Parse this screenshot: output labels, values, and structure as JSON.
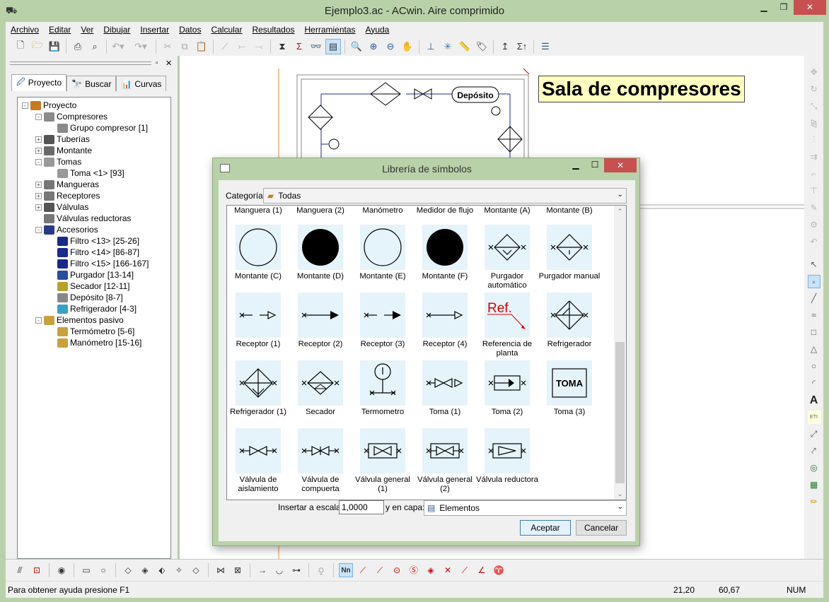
{
  "window": {
    "title": "Ejemplo3.ac - ACwin. Aire comprimido"
  },
  "menu": [
    "Archivo",
    "Editar",
    "Ver",
    "Dibujar",
    "Insertar",
    "Datos",
    "Calcular",
    "Resultados",
    "Herramientas",
    "Ayuda"
  ],
  "panel": {
    "tabs": [
      "Proyecto",
      "Buscar",
      "Curvas"
    ]
  },
  "tree": [
    {
      "label": "Proyecto",
      "level": 0,
      "exp": "-",
      "icon": "folder-icon"
    },
    {
      "label": "Compresores",
      "level": 1,
      "exp": "-",
      "icon": "compressor-icon"
    },
    {
      "label": "Grupo compresor [1]",
      "level": 2,
      "exp": "",
      "icon": "compressor-icon"
    },
    {
      "label": "Tuberías",
      "level": 1,
      "exp": "+",
      "icon": "pipe-icon"
    },
    {
      "label": "Montante",
      "level": 1,
      "exp": "+",
      "icon": "riser-icon"
    },
    {
      "label": "Tomas",
      "level": 1,
      "exp": "-",
      "icon": "outlet-icon"
    },
    {
      "label": "Toma <1> [93]",
      "level": 2,
      "exp": "",
      "icon": "outlet-icon"
    },
    {
      "label": "Mangueras",
      "level": 1,
      "exp": "+",
      "icon": "hose-icon"
    },
    {
      "label": "Receptores",
      "level": 1,
      "exp": "+",
      "icon": "receiver-icon"
    },
    {
      "label": "Válvulas",
      "level": 1,
      "exp": "+",
      "icon": "valve-icon"
    },
    {
      "label": "Válvulas reductoras",
      "level": 1,
      "exp": "",
      "icon": "reducing-valve-icon"
    },
    {
      "label": "Accesorios",
      "level": 1,
      "exp": "-",
      "icon": "accessory-icon"
    },
    {
      "label": "Filtro <13> [25-26]",
      "level": 2,
      "exp": "",
      "icon": "filter-icon"
    },
    {
      "label": "Filtro <14> [86-87]",
      "level": 2,
      "exp": "",
      "icon": "filter-icon"
    },
    {
      "label": "Filtro <15> [166-167]",
      "level": 2,
      "exp": "",
      "icon": "filter-icon"
    },
    {
      "label": "Purgador [13-14]",
      "level": 2,
      "exp": "",
      "icon": "drain-icon"
    },
    {
      "label": "Secador [12-11]",
      "level": 2,
      "exp": "",
      "icon": "dryer-icon"
    },
    {
      "label": "Depósito [8-7]",
      "level": 2,
      "exp": "",
      "icon": "tank-icon"
    },
    {
      "label": "Refrigerador [4-3]",
      "level": 2,
      "exp": "",
      "icon": "cooler-icon"
    },
    {
      "label": "Elementos pasivo",
      "level": 1,
      "exp": "-",
      "icon": "gauge-icon"
    },
    {
      "label": "Termómetro [5-6]",
      "level": 2,
      "exp": "",
      "icon": "gauge-icon"
    },
    {
      "label": "Manómetro [15-16]",
      "level": 2,
      "exp": "",
      "icon": "gauge-icon"
    }
  ],
  "canvas": {
    "room_label": "Sala de compresores",
    "tank_label": "Depósito"
  },
  "dialog": {
    "title": "Librería de símbolos",
    "category_label": "Categoría:",
    "category_value": "Todas",
    "header_labels": [
      "Manguera (1)",
      "Manguera (2)",
      "Manómetro",
      "Medidor de flujo",
      "Montante (A)",
      "Montante (B)"
    ],
    "symbols": [
      {
        "label": "Montante (C)",
        "kind": "circle-open"
      },
      {
        "label": "Montante (D)",
        "kind": "circle-filled"
      },
      {
        "label": "Montante (E)",
        "kind": "circle-open"
      },
      {
        "label": "Montante (F)",
        "kind": "circle-filled"
      },
      {
        "label": "Purgador automático",
        "kind": "drain-auto"
      },
      {
        "label": "Purgador manual",
        "kind": "drain-manual"
      },
      {
        "label": "Receptor (1)",
        "kind": "recv1"
      },
      {
        "label": "Receptor (2)",
        "kind": "recv2"
      },
      {
        "label": "Receptor (3)",
        "kind": "recv3"
      },
      {
        "label": "Receptor (4)",
        "kind": "recv4"
      },
      {
        "label": "Referencia de planta",
        "kind": "ref"
      },
      {
        "label": "Refrigerador",
        "kind": "cooler"
      },
      {
        "label": "Refrigerador (1)",
        "kind": "cooler1"
      },
      {
        "label": "Secador",
        "kind": "dryer"
      },
      {
        "label": "Termometro",
        "kind": "thermo"
      },
      {
        "label": "Toma (1)",
        "kind": "toma1"
      },
      {
        "label": "Toma (2)",
        "kind": "toma2"
      },
      {
        "label": "Toma (3)",
        "kind": "toma3"
      },
      {
        "label": "Válvula de aislamiento",
        "kind": "v-iso"
      },
      {
        "label": "Válvula de compuerta",
        "kind": "v-gate"
      },
      {
        "label": "Válvula general (1)",
        "kind": "v-gen1"
      },
      {
        "label": "Válvula general (2)",
        "kind": "v-gen2"
      },
      {
        "label": "Válvula reductora",
        "kind": "v-red"
      }
    ],
    "ref_text": "Ref.",
    "toma_text": "TOMA",
    "scale_label": "Insertar a escala:",
    "scale_value": "1,0000",
    "layer_label": "y en capa:",
    "layer_value": "Elementos",
    "accept": "Aceptar",
    "cancel": "Cancelar"
  },
  "status": {
    "help": "Para obtener ayuda presione F1",
    "x": "21,20",
    "y": "60,67",
    "num": "NUM"
  }
}
